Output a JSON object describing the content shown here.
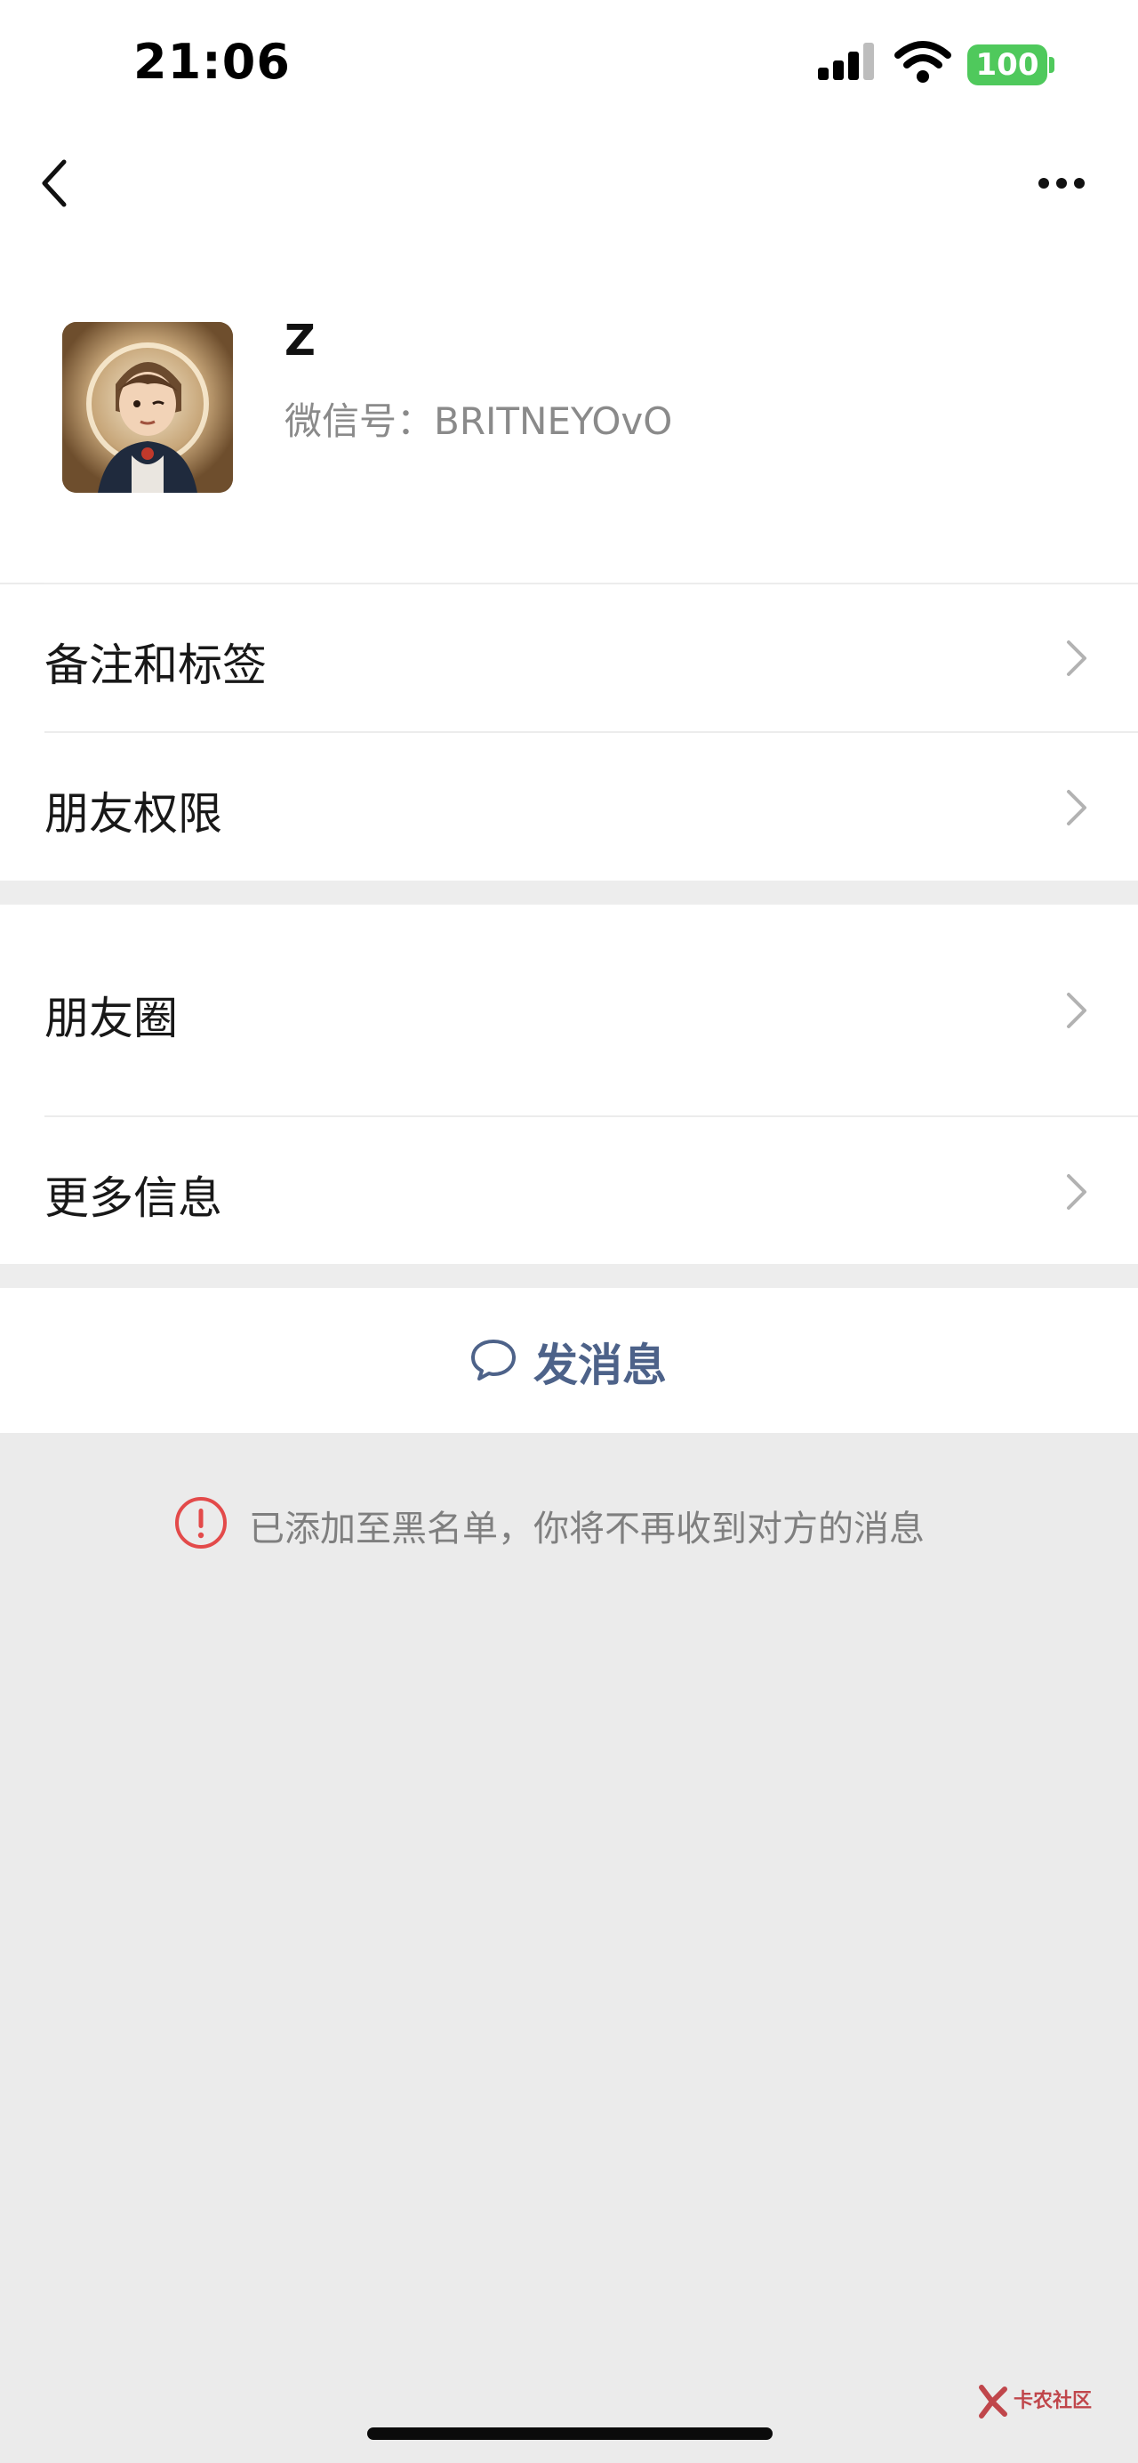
{
  "status_bar": {
    "time": "21:06",
    "battery": "100"
  },
  "profile": {
    "name": "Z",
    "wechat_id": "微信号：BRITNEYOvO"
  },
  "rows": {
    "remark_tags": "备注和标签",
    "friend_permissions": "朋友权限",
    "moments": "朋友圈",
    "more_info": "更多信息"
  },
  "actions": {
    "send_message": "发消息"
  },
  "notice": {
    "text": "已添加至黑名单，你将不再收到对方的消息"
  },
  "watermark": {
    "text": "卡农社区"
  },
  "colors": {
    "accent_blue": "#4d6289",
    "warning_red": "#e34a4a",
    "battery_green": "#4fc95c",
    "background_gray": "#ebebeb"
  }
}
